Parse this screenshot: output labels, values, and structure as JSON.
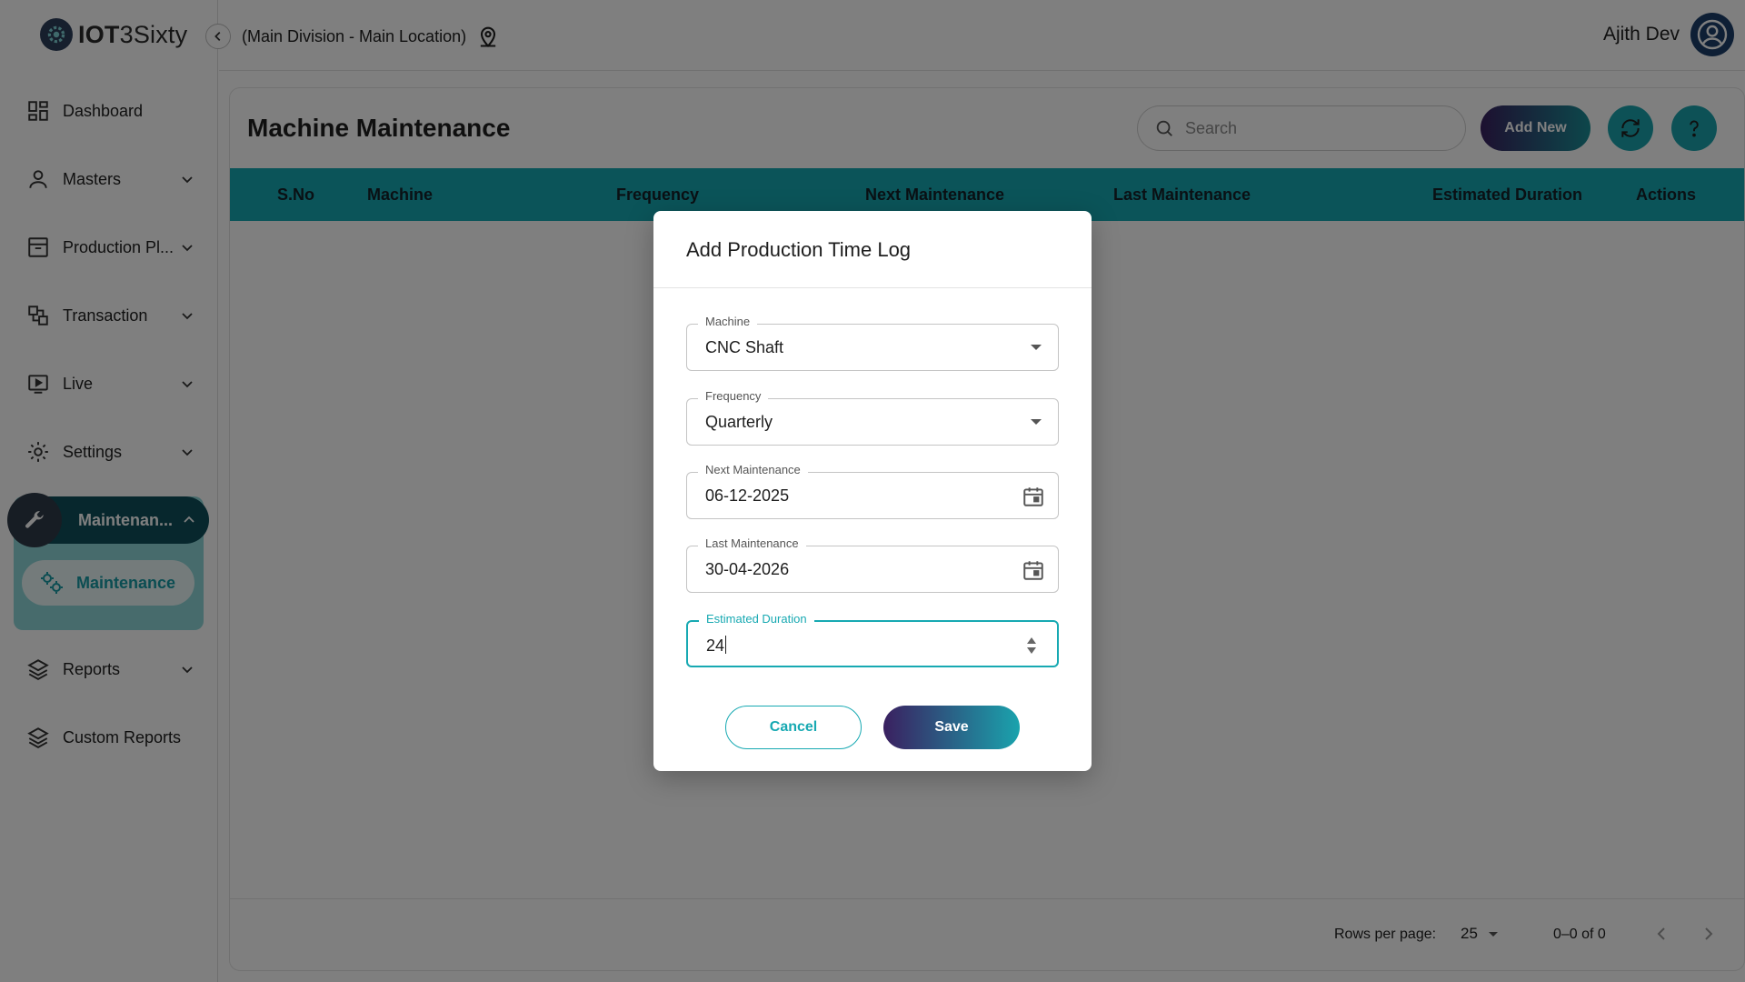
{
  "app": {
    "logo_bold": "IOT",
    "logo_rest": "3Sixty",
    "division": "(Main Division - Main Location)",
    "user_name": "Ajith Dev"
  },
  "sidebar": {
    "items": [
      {
        "label": "Dashboard",
        "icon": "dashboard-icon"
      },
      {
        "label": "Masters",
        "icon": "person-icon"
      },
      {
        "label": "Production Pl...",
        "icon": "archive-icon"
      },
      {
        "label": "Transaction",
        "icon": "transaction-icon"
      },
      {
        "label": "Live",
        "icon": "live-icon"
      },
      {
        "label": "Settings",
        "icon": "gear-icon"
      },
      {
        "label": "Maintenan...",
        "icon": "wrench-icon"
      },
      {
        "label": "Maintenance",
        "icon": "gears-icon"
      },
      {
        "label": "Reports",
        "icon": "layers-icon"
      },
      {
        "label": "Custom Reports",
        "icon": "layers-icon"
      }
    ]
  },
  "main": {
    "title": "Machine Maintenance",
    "search_placeholder": "Search",
    "add_label": "Add New",
    "columns": [
      "S.No",
      "Machine",
      "Frequency",
      "Next Maintenance",
      "Last Maintenance",
      "Estimated Duration",
      "Actions"
    ],
    "rows": [],
    "pagination": {
      "rows_per_page_label": "Rows per page:",
      "rows_per_page": "25",
      "range": "0–0 of 0"
    }
  },
  "modal": {
    "title": "Add Production Time Log",
    "fields": [
      {
        "label": "Machine",
        "value": "CNC Shaft"
      },
      {
        "label": "Frequency",
        "value": "Quarterly"
      },
      {
        "label": "Next Maintenance",
        "value": "06-12-2025"
      },
      {
        "label": "Last Maintenance",
        "value": "30-04-2026"
      },
      {
        "label": "Estimated Duration",
        "value": "24"
      }
    ],
    "cancel_label": "Cancel",
    "save_label": "Save"
  },
  "colors": {
    "accent": "#17a9b2",
    "active_nav": "#0f4f5a",
    "brand_dark": "#3a2060"
  }
}
